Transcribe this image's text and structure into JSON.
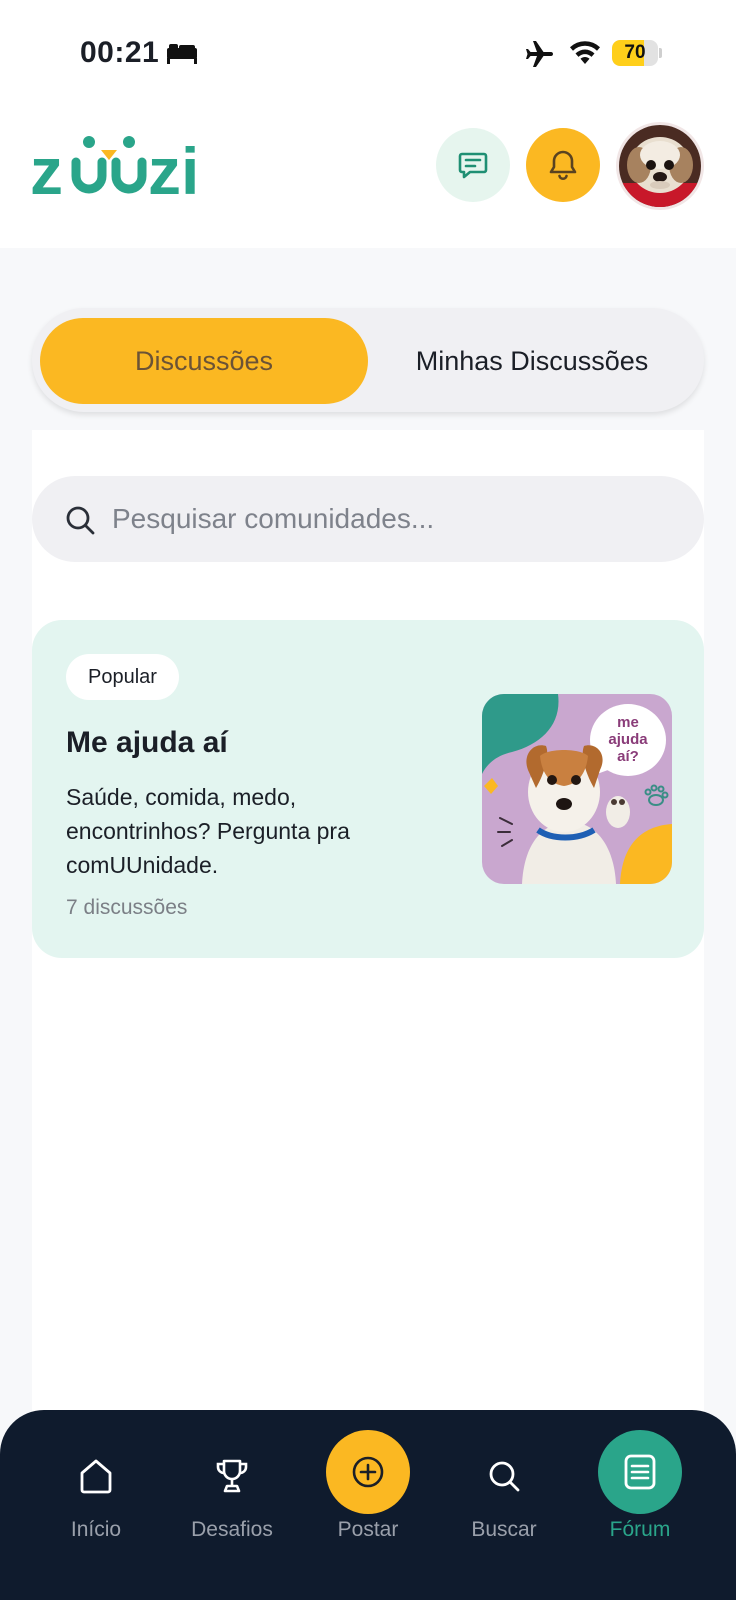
{
  "status_bar": {
    "time": "00:21",
    "battery": "70",
    "battery_level": 0.7,
    "icons": [
      "bed-icon",
      "airplane-icon",
      "wifi-icon",
      "battery-icon"
    ]
  },
  "header": {
    "logo": "zuuzi",
    "buttons": [
      "chat-icon",
      "bell-icon",
      "profile-avatar"
    ]
  },
  "tabs": {
    "active": "Discussões",
    "inactive": "Minhas Discussões"
  },
  "search": {
    "placeholder": "Pesquisar comunidades...",
    "value": ""
  },
  "community": {
    "badge": "Popular",
    "title": "Me ajuda aí",
    "description": "Saúde, comida, medo, encontrinhos? Pergunta pra comUUnidade.",
    "count": "7 discussões",
    "image_text": [
      "me",
      "ajuda",
      "aí?"
    ]
  },
  "bottom_nav": {
    "items": [
      {
        "label": "Início",
        "icon": "home-icon"
      },
      {
        "label": "Desafios",
        "icon": "trophy-icon"
      },
      {
        "label": "Postar",
        "icon": "plus-circle-icon"
      },
      {
        "label": "Buscar",
        "icon": "search-icon"
      },
      {
        "label": "Fórum",
        "icon": "forum-icon"
      }
    ],
    "active": "Fórum"
  },
  "colors": {
    "brand_teal": "#2aa58a",
    "accent_yellow": "#fbb822",
    "nav_bg": "#0f1b2d",
    "card_bg": "#e3f5f0"
  }
}
